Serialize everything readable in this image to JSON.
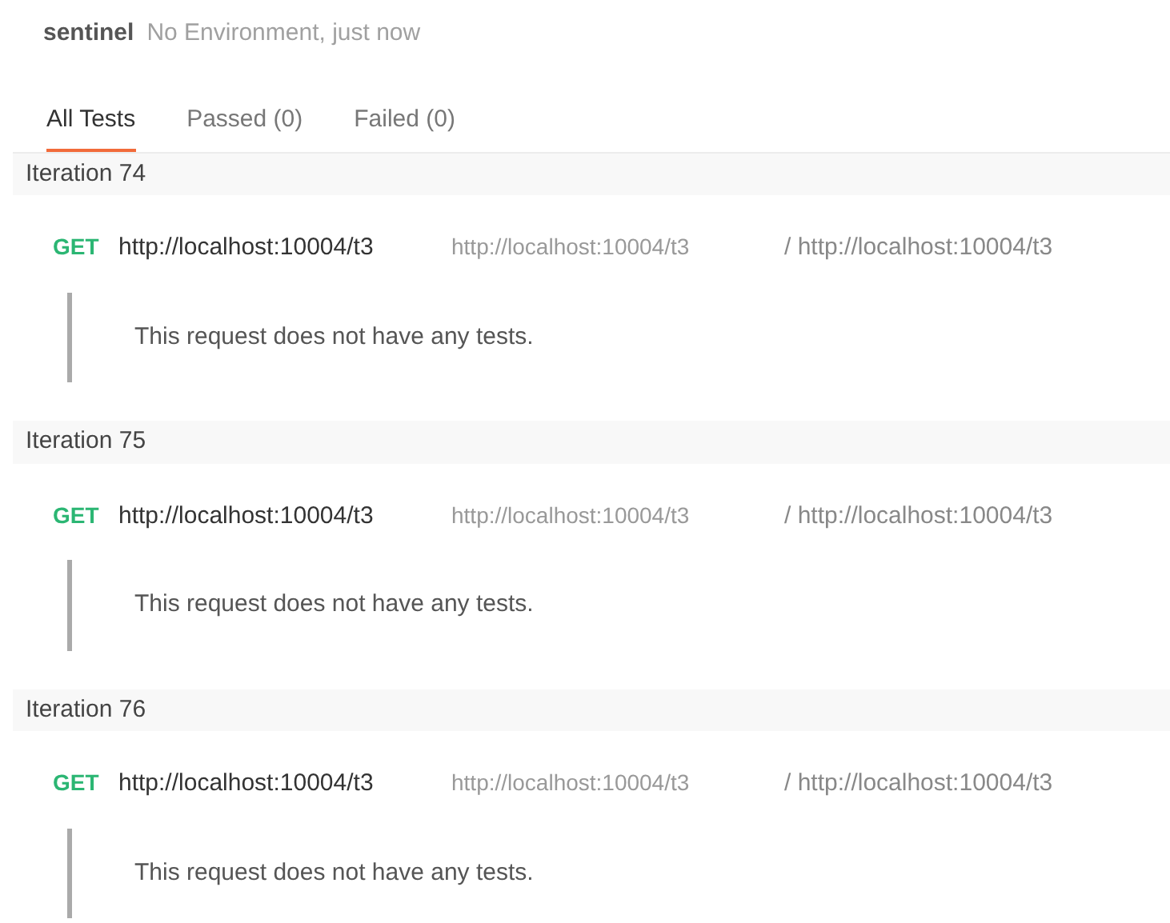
{
  "header": {
    "collection": "sentinel",
    "meta": "No Environment, just now"
  },
  "tabs": [
    {
      "label": "All Tests",
      "selected": true
    },
    {
      "label": "Passed (0)",
      "selected": false
    },
    {
      "label": "Failed (0)",
      "selected": false
    }
  ],
  "iterations": [
    {
      "title": "Iteration 74",
      "requests": [
        {
          "method": "GET",
          "name": "http://localhost:10004/t3",
          "url": "http://localhost:10004/t3",
          "path": "/ http://localhost:10004/t3",
          "message": "This request does not have any tests."
        }
      ]
    },
    {
      "title": "Iteration 75",
      "requests": [
        {
          "method": "GET",
          "name": "http://localhost:10004/t3",
          "url": "http://localhost:10004/t3",
          "path": "/ http://localhost:10004/t3",
          "message": "This request does not have any tests."
        }
      ]
    },
    {
      "title": "Iteration 76",
      "requests": [
        {
          "method": "GET",
          "name": "http://localhost:10004/t3",
          "url": "http://localhost:10004/t3",
          "path": "/ http://localhost:10004/t3",
          "message": "This request does not have any tests."
        }
      ]
    }
  ]
}
